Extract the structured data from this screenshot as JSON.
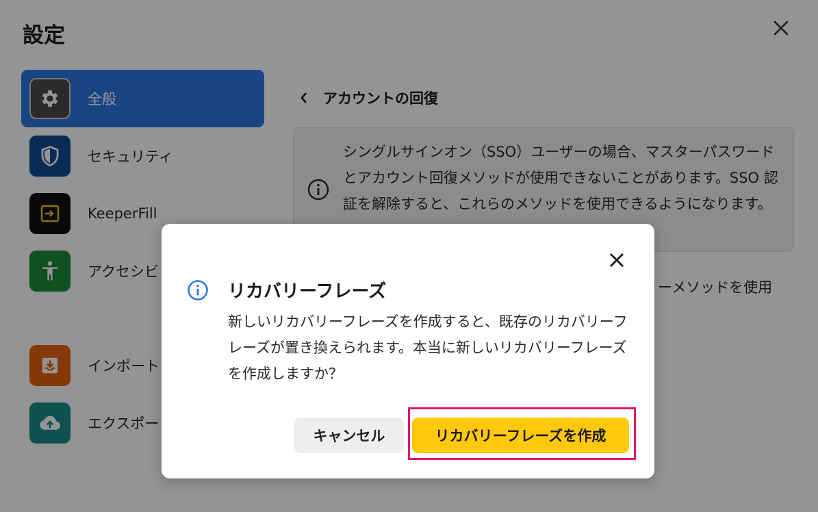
{
  "page": {
    "title": "設定"
  },
  "sidebar": {
    "items": [
      {
        "label": "全般",
        "icon": "gear-icon",
        "color": "#4a4a4a",
        "active": true
      },
      {
        "label": "セキュリティ",
        "icon": "shield-icon",
        "color": "#114c92"
      },
      {
        "label": "KeeperFill",
        "icon": "keeperfill-icon",
        "color": "#111111"
      },
      {
        "label": "アクセシビ",
        "icon": "accessibility-icon",
        "color": "#1c8a3a"
      },
      {
        "label": "インポート",
        "icon": "import-icon",
        "color": "#e3640e"
      },
      {
        "label": "エクスポー",
        "icon": "cloud-upload-icon",
        "color": "#1b8a8a"
      }
    ]
  },
  "content": {
    "title": "アカウントの回復",
    "info_text": "シングルサインオン（SSO）ユーザーの場合、マスターパスワードとアカウント回復メソッドが使用できないことがあります。SSO 認証を解除すると、これらのメソッドを使用できるようになります。",
    "behind_text": "リーメソッドを使用"
  },
  "dialog": {
    "title": "リカバリーフレーズ",
    "body": "新しいリカバリーフレーズを作成すると、既存のリカバリーフレーズが置き換えられます。本当に新しいリカバリーフレーズを作成しますか？",
    "cancel_label": "キャンセル",
    "confirm_label": "リカバリーフレーズを作成"
  },
  "colors": {
    "accent": "#2d77e6",
    "confirm": "#ffc80a",
    "highlight": "#e2186e",
    "info_icon": "#2d77e6"
  }
}
